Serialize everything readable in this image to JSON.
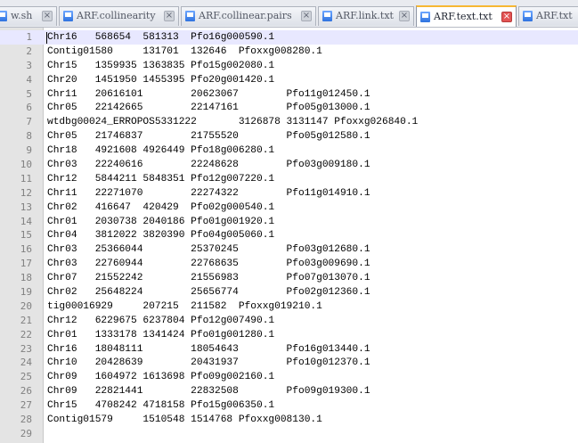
{
  "tabs": [
    {
      "label": "w.sh",
      "active": false
    },
    {
      "label": "ARF.collinearity",
      "active": false
    },
    {
      "label": "ARF.collinear.pairs",
      "active": false
    },
    {
      "label": "ARF.link.txt",
      "active": false
    },
    {
      "label": "ARF.text.txt",
      "active": true
    },
    {
      "label": "ARF.txt",
      "active": false
    }
  ],
  "lines": [
    {
      "n": "1",
      "text": "Chr16\t568654\t581313\tPfo16g000590.1"
    },
    {
      "n": "2",
      "text": "Contig01580\t131701\t132646\tPfoxxg008280.1"
    },
    {
      "n": "3",
      "text": "Chr15\t1359935\t1363835\tPfo15g002080.1"
    },
    {
      "n": "4",
      "text": "Chr20\t1451950\t1455395\tPfo20g001420.1"
    },
    {
      "n": "5",
      "text": "Chr11\t20616101\t20623067\tPfo11g012450.1"
    },
    {
      "n": "6",
      "text": "Chr05\t22142665\t22147161\tPfo05g013000.1"
    },
    {
      "n": "7",
      "text": "wtdbg00024_ERROPOS5331222\t3126878\t3131147\tPfoxxg026840.1"
    },
    {
      "n": "8",
      "text": "Chr05\t21746837\t21755520\tPfo05g012580.1"
    },
    {
      "n": "9",
      "text": "Chr18\t4921608\t4926449\tPfo18g006280.1"
    },
    {
      "n": "10",
      "text": "Chr03\t22240616\t22248628\tPfo03g009180.1"
    },
    {
      "n": "11",
      "text": "Chr12\t5844211\t5848351\tPfo12g007220.1"
    },
    {
      "n": "12",
      "text": "Chr11\t22271070\t22274322\tPfo11g014910.1"
    },
    {
      "n": "13",
      "text": "Chr02\t416647\t420429\tPfo02g000540.1"
    },
    {
      "n": "14",
      "text": "Chr01\t2030738\t2040186\tPfo01g001920.1"
    },
    {
      "n": "15",
      "text": "Chr04\t3812022\t3820390\tPfo04g005060.1"
    },
    {
      "n": "16",
      "text": "Chr03\t25366044\t25370245\tPfo03g012680.1"
    },
    {
      "n": "17",
      "text": "Chr03\t22760944\t22768635\tPfo03g009690.1"
    },
    {
      "n": "18",
      "text": "Chr07\t21552242\t21556983\tPfo07g013070.1"
    },
    {
      "n": "19",
      "text": "Chr02\t25648224\t25656774\tPfo02g012360.1"
    },
    {
      "n": "20",
      "text": "tig00016929\t207215\t211582\tPfoxxg019210.1"
    },
    {
      "n": "21",
      "text": "Chr12\t6229675\t6237804\tPfo12g007490.1"
    },
    {
      "n": "22",
      "text": "Chr01\t1333178\t1341424\tPfo01g001280.1"
    },
    {
      "n": "23",
      "text": "Chr16\t18048111\t18054643\tPfo16g013440.1"
    },
    {
      "n": "24",
      "text": "Chr10\t20428639\t20431937\tPfo10g012370.1"
    },
    {
      "n": "25",
      "text": "Chr09\t1604972\t1613698\tPfo09g002160.1"
    },
    {
      "n": "26",
      "text": "Chr09\t22821441\t22832508\tPfo09g019300.1"
    },
    {
      "n": "27",
      "text": "Chr15\t4708242\t4718158\tPfo15g006350.1"
    },
    {
      "n": "28",
      "text": "Contig01579\t1510548\t1514768\tPfoxxg008130.1"
    },
    {
      "n": "29",
      "text": ""
    }
  ],
  "colors": {
    "active_tab_accent": "#f7b733",
    "close_active": "#e35454",
    "current_line": "#e8e8ff",
    "gutter": "#e4e4e4"
  },
  "icons": {
    "tab_file": "file-icon",
    "tab_close": "close-icon"
  }
}
